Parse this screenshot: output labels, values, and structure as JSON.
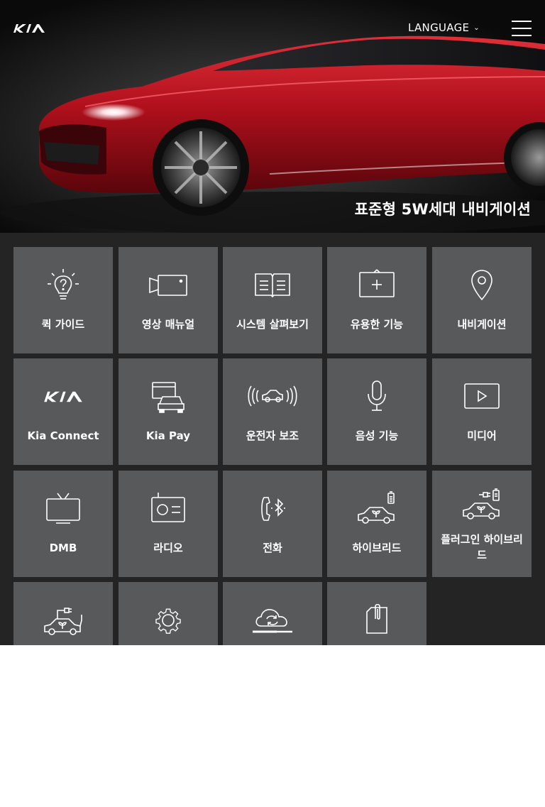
{
  "header": {
    "language_label": "LANGUAGE",
    "hero_title": "표준형 5W세대 내비게이션"
  },
  "icons": {
    "logo": "kia-logo",
    "menu": "hamburger-icon",
    "language_chevron": "chevron-down-icon"
  },
  "colors": {
    "tile_bg": "#58595b",
    "grid_bg": "#242424",
    "car_red": "#c8102e"
  },
  "menu_tiles": [
    {
      "label": "퀵 가이드",
      "icon": "lightbulb-question-icon"
    },
    {
      "label": "영상 매뉴얼",
      "icon": "video-camera-icon"
    },
    {
      "label": "시스템 살펴보기",
      "icon": "open-book-icon"
    },
    {
      "label": "유용한 기능",
      "icon": "plus-box-icon"
    },
    {
      "label": "내비게이션",
      "icon": "map-pin-icon"
    },
    {
      "label": "Kia Connect",
      "icon": "kia-logo-icon"
    },
    {
      "label": "Kia Pay",
      "icon": "card-car-icon"
    },
    {
      "label": "운전자 보조",
      "icon": "car-sensor-icon"
    },
    {
      "label": "음성 기능",
      "icon": "microphone-icon"
    },
    {
      "label": "미디어",
      "icon": "play-screen-icon"
    },
    {
      "label": "DMB",
      "icon": "tv-icon"
    },
    {
      "label": "라디오",
      "icon": "radio-icon"
    },
    {
      "label": "전화",
      "icon": "phone-bluetooth-icon"
    },
    {
      "label": "하이브리드",
      "icon": "hybrid-car-icon"
    },
    {
      "label": "플러그인 하이브리드",
      "icon": "plugin-hybrid-car-icon"
    },
    {
      "label": "",
      "icon": "ev-car-plug-icon"
    },
    {
      "label": "",
      "icon": "gear-icon"
    },
    {
      "label": "",
      "icon": "cloud-sync-icon"
    },
    {
      "label": "",
      "icon": "clip-document-icon"
    }
  ]
}
